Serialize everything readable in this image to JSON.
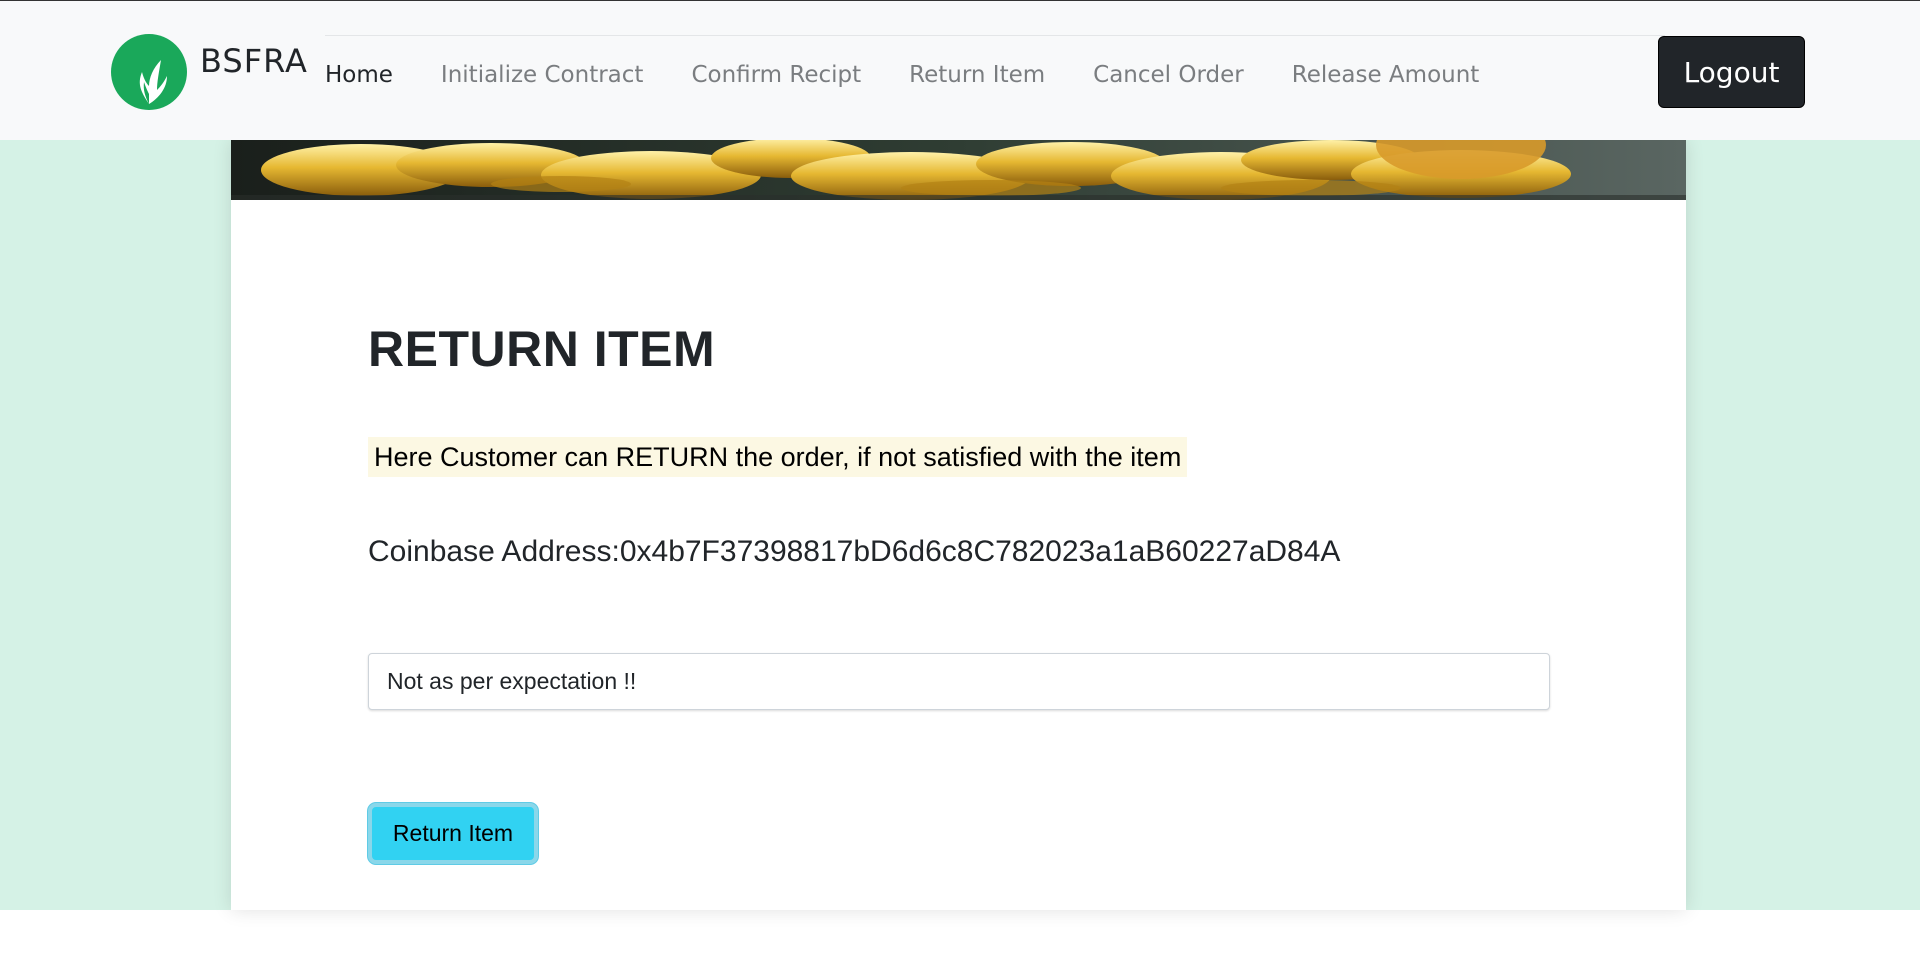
{
  "brand": {
    "name": "BSFRA",
    "logo_icon": "green-leaf-logo-icon",
    "logo_color": "#1aa85a"
  },
  "nav": {
    "items": [
      {
        "label": "Home",
        "active": true
      },
      {
        "label": "Initialize Contract",
        "active": false
      },
      {
        "label": "Confirm Recipt",
        "active": false
      },
      {
        "label": "Return Item",
        "active": false
      },
      {
        "label": "Cancel Order",
        "active": false
      },
      {
        "label": "Release Amount",
        "active": false
      }
    ],
    "logout_label": "Logout"
  },
  "banner": {
    "image": "gold-coins-banner"
  },
  "main": {
    "title": "RETURN ITEM",
    "description": "Here Customer can RETURN the order, if not satisfied with the item",
    "coinbase_address": "Coinbase Address:0x4b7F37398817bD6d6c8C782023a1aB60227aD84A",
    "reason_input_value": "Not as per expectation !!",
    "return_button_label": "Return Item"
  },
  "colors": {
    "page_background": "#d5f2e6",
    "navbar_background": "#f8f9fa",
    "logout_button": "#212529",
    "return_button": "#31d2f2",
    "highlight": "#fcf8e3"
  }
}
